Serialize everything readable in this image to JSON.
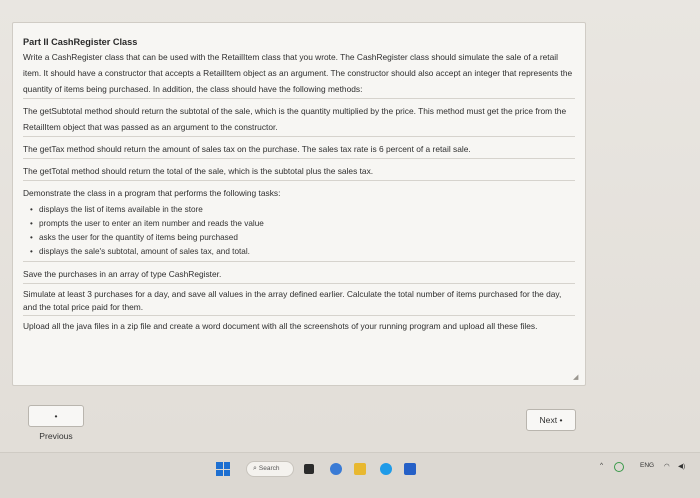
{
  "question": {
    "title": "Part II CashRegister Class",
    "intro": "Write a CashRegister class that can be used with the RetailItem class that you wrote. The CashRegister class should simulate the sale of a retail item. It should have a constructor that accepts a RetailItem object as an argument. The constructor should also accept an integer that represents the quantity of items being purchased. In addition, the class should have the following methods:",
    "getsubtotal": "The getSubtotal method should return the subtotal of the sale, which is the quantity multiplied by the price. This method must get the price from the RetailItem object that was passed as an argument to the constructor.",
    "gettax": "The getTax method should return the amount of sales tax on the purchase. The sales tax rate is 6 percent of a retail sale.",
    "gettotal": "The getTotal method should return the total of the sale, which is the subtotal plus the sales tax.",
    "demonstrate": "Demonstrate the class in a program that performs the following tasks:",
    "tasks": [
      "displays the list of items available in the store",
      "prompts the user to enter an item number and reads the value",
      "asks the user for the quantity of items being purchased",
      "displays the sale's subtotal, amount of sales tax, and total."
    ],
    "save": "Save the purchases in an array of type CashRegister.",
    "simulate": "Simulate at least 3 purchases for a day, and save all values in the array defined earlier. Calculate the total number of items purchased for the day, and the total price paid for them.",
    "upload": "Upload all the java files in a zip file and create a word document with all the screenshots of your running program and upload all these files."
  },
  "navigation": {
    "previous_label": "• Previous",
    "next_label": "Next •"
  },
  "taskbar": {
    "search_placeholder": "Search",
    "language": "ENG",
    "icons": [
      "windows-start-icon",
      "search-icon",
      "file-explorer-icon",
      "video-call-icon",
      "folder-icon",
      "edge-icon",
      "store-icon"
    ]
  },
  "colors": {
    "start_blue": "#1d6fd1"
  }
}
